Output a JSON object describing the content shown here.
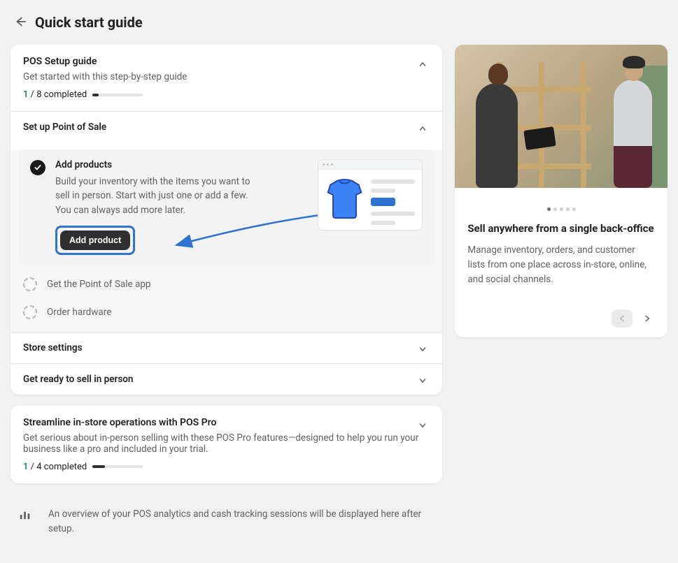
{
  "pageTitle": "Quick start guide",
  "guide1": {
    "title": "POS Setup guide",
    "subtitle": "Get started with this step-by-step guide",
    "progressDone": "1",
    "progressOf": "/ 8 completed",
    "progressPct": 12.5,
    "sections": {
      "s1": {
        "label": "Set up Point of Sale",
        "tasks": {
          "active": {
            "title": "Add products",
            "desc": "Build your inventory with the items you want to sell in person. Start with just one or add a few. You can always add more later.",
            "cta": "Add product"
          },
          "t2": "Get the Point of Sale app",
          "t3": "Order hardware"
        }
      },
      "s2": {
        "label": "Store settings"
      },
      "s3": {
        "label": "Get ready to sell in person"
      }
    }
  },
  "guide2": {
    "title": "Streamline in-store operations with POS Pro",
    "subtitle": "Get serious about in-person selling with these POS Pro features—designed to help you run your business like a pro and included in your trial.",
    "progressDone": "1",
    "progressOf": "/ 4 completed",
    "progressPct": 25
  },
  "analytics": {
    "text": "An overview of your POS analytics and cash tracking sessions will be displayed here after setup."
  },
  "sidebar": {
    "title": "Sell anywhere from a single back-office",
    "desc": "Manage inventory, orders, and customer lists from one place across in-store, online, and social channels."
  }
}
